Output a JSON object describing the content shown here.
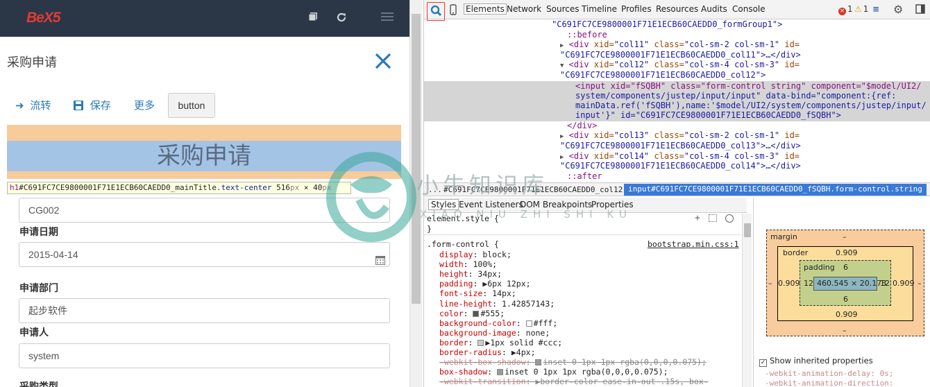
{
  "app": {
    "logo": "BeX5"
  },
  "page": {
    "title": "采购申请",
    "main_title": "采购申请"
  },
  "actions": {
    "forward": "流转",
    "save": "保存",
    "more": "更多",
    "button": "button"
  },
  "tooltip": {
    "tag": "h1",
    "id": "#C691FC7CE9800001F71E1ECB60CAEDD0_mainTitle",
    "cls": ".text-center",
    "w": "516",
    "x": " × ",
    "h": "40",
    "px1": "px",
    "px2": "px"
  },
  "form": {
    "order_no": "CG002",
    "date_label": "申请日期",
    "date_value": "2015-04-14",
    "dept_label": "申请部门",
    "dept_value": "起步软件",
    "person_label": "申请人",
    "person_value": "system",
    "type_label": "采购类型"
  },
  "devtools": {
    "tabs": [
      "Elements",
      "Network",
      "Sources",
      "Timeline",
      "Profiles",
      "Resources",
      "Audits",
      "Console"
    ],
    "errors": "1",
    "warnings": "1",
    "dom": {
      "l1": "\"C691FC7CE9800001F71E1ECB60CAEDD0_formGroup1\">",
      "l2": "::before",
      "l3a": "<div ",
      "l3b": "xid=",
      "l3c": "\"col11\"",
      "l3d": " class=",
      "l3e": "\"col-sm-2 col-sm-1\"",
      "l3f": " id=",
      "l4": "\"C691FC7CE9800001F71E1ECB60CAEDD0_col11\">…</div>",
      "l5a": "<div ",
      "l5b": "xid=",
      "l5c": "\"col12\"",
      "l5d": " class=",
      "l5e": "\"col-sm-4 col-sm-3\"",
      "l5f": " id=",
      "l6": "\"C691FC7CE9800001F71E1ECB60CAEDD0_col12\">",
      "l7": "<input xid=\"fSQBH\" class=\"form-control string\" component=\"$model/UI2/",
      "l8": "system/components/justep/input/input\" data-bind=\"component:{ref:",
      "l9": "mainData.ref('fSQBH'),name:'$model/UI2/system/components/justep/input/",
      "l10": "input'}\" id=\"C691FC7CE9800001F71E1ECB60CAEDD0_fSQBH\">",
      "l11": "</div>",
      "l12a": "<div ",
      "l12b": "xid=",
      "l12c": "\"col13\"",
      "l12d": " class=",
      "l12e": "\"col-sm-2 col-sm-1\"",
      "l12f": " id=",
      "l13": "\"C691FC7CE9800001F71E1ECB60CAEDD0_col13\">…</div>",
      "l14a": "<div ",
      "l14b": "xid=",
      "l14c": "\"col14\"",
      "l14d": " class=",
      "l14e": "\"col-sm-4 col-sm-3\"",
      "l14f": " id=",
      "l15": "\"C691FC7CE9800001F71E1ECB60CAEDD0_col14\">…</div>",
      "l16": "::after"
    },
    "breadcrumb": {
      "ellipsis": "...",
      "item1": "#C691FC7CE9800001F71E1ECB60CAEDD0_col12",
      "item2": "input#C691FC7CE9800001F71E1ECB60CAEDD0_fSQBH.form-control.string"
    },
    "sub_tabs": [
      "Styles",
      "Event Listeners",
      "DOM Breakpoints",
      "Properties"
    ],
    "styles": {
      "element_style": "element.style {",
      "close1": "}",
      "rule_selector": ".form-control {",
      "source": "bootstrap.min.css:1",
      "props": [
        {
          "n": "display",
          "v": "block;"
        },
        {
          "n": "width",
          "v": "100%;"
        },
        {
          "n": "height",
          "v": "34px;"
        },
        {
          "n": "padding",
          "v": "▶6px 12px;"
        },
        {
          "n": "font-size",
          "v": "14px;"
        },
        {
          "n": "line-height",
          "v": "1.42857143;"
        },
        {
          "n": "color",
          "v": "#555;"
        },
        {
          "n": "background-color",
          "v": "#fff;"
        },
        {
          "n": "background-image",
          "v": "none;"
        },
        {
          "n": "border",
          "v": "▶1px solid  #ccc;"
        },
        {
          "n": "border-radius",
          "v": "▶4px;"
        },
        {
          "n": "-webkit-box-shadow",
          "v": "inset 0 1px 1px  rgba(0,0,0,0.075);"
        },
        {
          "n": "box-shadow",
          "v": "inset 0 1px 1px  rgba(0,0,0,0.075);"
        },
        {
          "n": "-webkit-transition",
          "v": "▶border-color ease-in-out .15s, box-"
        }
      ]
    },
    "box_model": {
      "margin_label": "margin",
      "margin_top": "–",
      "margin_bottom": "–",
      "margin_left": "–",
      "margin_right": "–",
      "border_label": "border",
      "border_top": "0.909",
      "border_bottom": "0.909",
      "border_left": "0.909",
      "border_right": "0.909",
      "padding_label": "padding",
      "padding_top": "6",
      "padding_bottom": "6",
      "padding_left": "12",
      "padding_right": "12",
      "content": "460.545 × 20.173"
    },
    "show_inherited": "Show inherited properties",
    "inherited": [
      "-webkit-animation-delay: 0s;",
      "-webkit-animation-direction:"
    ]
  },
  "watermark": {
    "main": "小牛知识库",
    "sub": "XIAO NIU ZHI SHI KU"
  },
  "colors": {
    "topbar": "#2b3746",
    "logo": "#e53935",
    "accent": "#2a7ab8",
    "selection": "#3879d9"
  }
}
